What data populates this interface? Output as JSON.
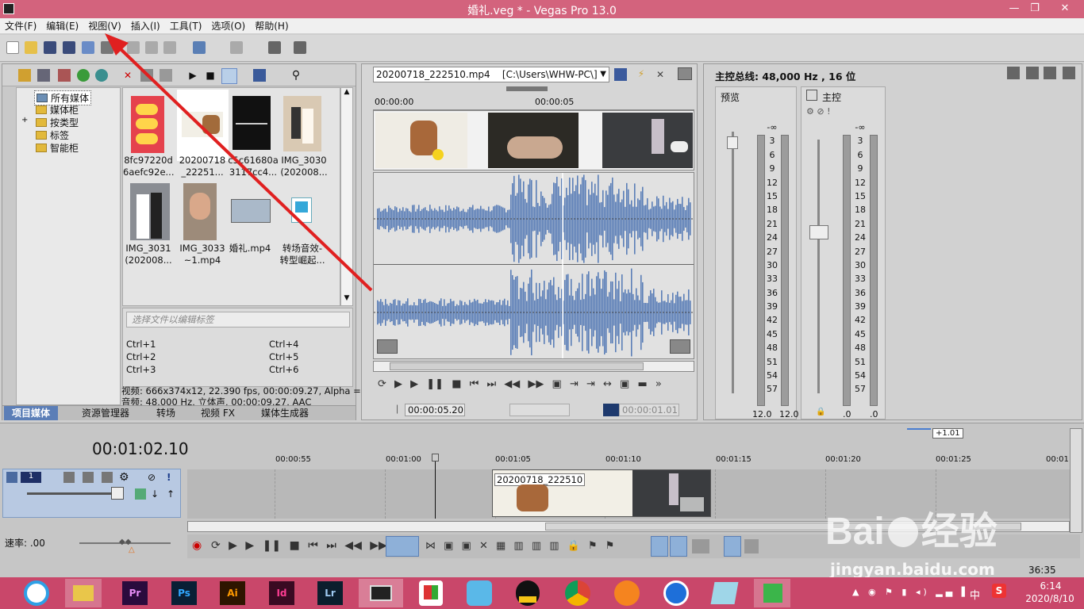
{
  "window": {
    "title": "婚礼.veg * - Vegas Pro 13.0"
  },
  "menu": [
    "文件(F)",
    "编辑(E)",
    "视图(V)",
    "插入(I)",
    "工具(T)",
    "选项(O)",
    "帮助(H)"
  ],
  "media_panel": {
    "tree": [
      "所有媒体",
      "媒体柜",
      "按类型",
      "标签",
      "智能柜"
    ],
    "thumbnails": [
      {
        "caption1": "8fc97220d",
        "caption2": "6aefc92e..."
      },
      {
        "caption1": "20200718",
        "caption2": "_22251..."
      },
      {
        "caption1": "c5c61680a",
        "caption2": "3117cc4..."
      },
      {
        "caption1": "IMG_3030",
        "caption2": "(202008..."
      },
      {
        "caption1": "IMG_3031",
        "caption2": "(202008..."
      },
      {
        "caption1": "IMG_3033",
        "caption2": "~1.mp4"
      },
      {
        "caption1": "婚礼.mp4",
        "caption2": ""
      },
      {
        "caption1": "转场音效-",
        "caption2": "转型崛起..."
      }
    ],
    "tag_placeholder": "选择文件以编辑标签",
    "shortcuts": [
      "Ctrl+1",
      "Ctrl+4",
      "Ctrl+2",
      "Ctrl+5",
      "Ctrl+3",
      "Ctrl+6"
    ],
    "info_line1": "视频: 666x374x12, 22.390 fps, 00:00:09.27, Alpha =",
    "info_line2": "音频: 48,000 Hz, 立体声, 00:00:09.27, AAC",
    "tabs": [
      "项目媒体",
      "资源管理器",
      "转场",
      "视频 FX",
      "媒体生成器"
    ]
  },
  "trimmer": {
    "file": "20200718_222510.mp4",
    "path": "[C:\\Users\\WHW-PC\\]",
    "time_start": "00:00:00",
    "time_mark": "00:00:05",
    "current_time": "00:00:05.20",
    "length": "00:00:01.01"
  },
  "master": {
    "header": "主控总线: 48,000 Hz , 16 位",
    "preview_label": "预览",
    "master_label": "主控",
    "scale": [
      "-∞",
      "3",
      "6",
      "9",
      "12",
      "15",
      "18",
      "21",
      "24",
      "27",
      "30",
      "33",
      "36",
      "39",
      "42",
      "45",
      "48",
      "51",
      "54",
      "57"
    ],
    "preview_left": "12.0",
    "preview_right": "12.0",
    "master_left": ".0",
    "master_right": ".0"
  },
  "timeline": {
    "time": "00:01:02.10",
    "rate_badge": "+1.01",
    "track_num": "1",
    "ruler": [
      "00:00:55",
      "00:01:00",
      "00:01:05",
      "00:01:10",
      "00:01:15",
      "00:01:20",
      "00:01:25",
      "00:01"
    ],
    "clip_label": "20200718_222510",
    "rate_label": "速率: .00",
    "end_time": "36:35"
  },
  "watermark": {
    "brand": "Bai",
    "brand2": "经验",
    "url": "jingyan.baidu.com"
  },
  "taskbar": {
    "clock_time": "6:14",
    "clock_date": "2020/8/10",
    "ime": "中",
    "apps": [
      "Pr",
      "Ps",
      "Ai",
      "Id",
      "Lr"
    ]
  },
  "colors": {
    "title_bg": "#d3637d",
    "waveform": "#5b7eb7",
    "arrow": "#e02020",
    "taskbar": "#c9476a"
  }
}
